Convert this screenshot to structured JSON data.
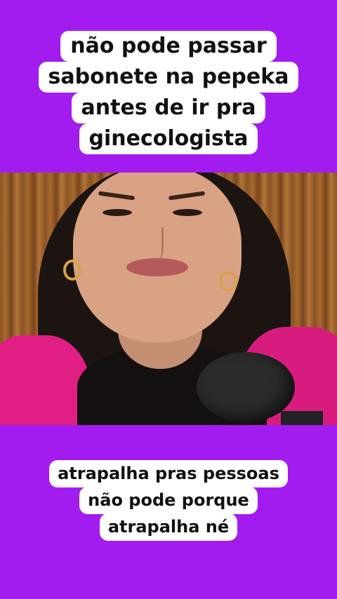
{
  "caption_top": {
    "lines": [
      "não pode passar",
      "sabonete na pepeka",
      "antes de ir pra",
      "ginecologista"
    ]
  },
  "caption_bottom": {
    "lines": [
      "atrapalha pras pessoas",
      "não pode porque",
      "atrapalha né"
    ]
  },
  "colors": {
    "background": "#a21cf0",
    "caption_bg": "#ffffff",
    "caption_text": "#111111"
  }
}
